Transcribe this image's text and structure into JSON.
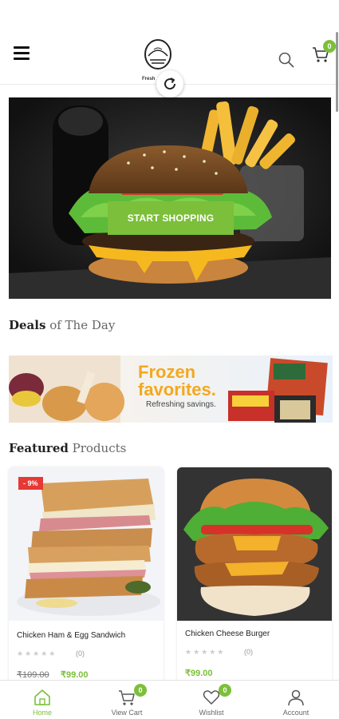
{
  "header": {
    "logo_text": "Fresh",
    "cart_count": "0"
  },
  "hero": {
    "button_label": "START SHOPPING"
  },
  "deals": {
    "title_bold": "Deals",
    "title_light": " of The Day",
    "banner_title": "Frozen favorites.",
    "banner_subtitle": "Refreshing savings."
  },
  "featured": {
    "title_bold": "Featured",
    "title_light": " Products",
    "products": [
      {
        "name": "Chicken Ham & Egg Sandwich",
        "discount": "- 9%",
        "stars": "★★★★★",
        "rating_count": "(0)",
        "old_price": "₹109.00",
        "new_price": "₹99.00"
      },
      {
        "name": "Chicken Cheese Burger",
        "stars": "★★★★★",
        "rating_count": "(0)",
        "new_price": "₹99.00"
      }
    ]
  },
  "bottom_nav": {
    "items": [
      {
        "label": "Home",
        "active": true
      },
      {
        "label": "View Cart",
        "badge": "0"
      },
      {
        "label": "Wishlist",
        "badge": "0"
      },
      {
        "label": "Account"
      }
    ]
  },
  "colors": {
    "accent": "#7cbf3a",
    "discount": "#e53935",
    "frozen": "#f3a81f"
  }
}
